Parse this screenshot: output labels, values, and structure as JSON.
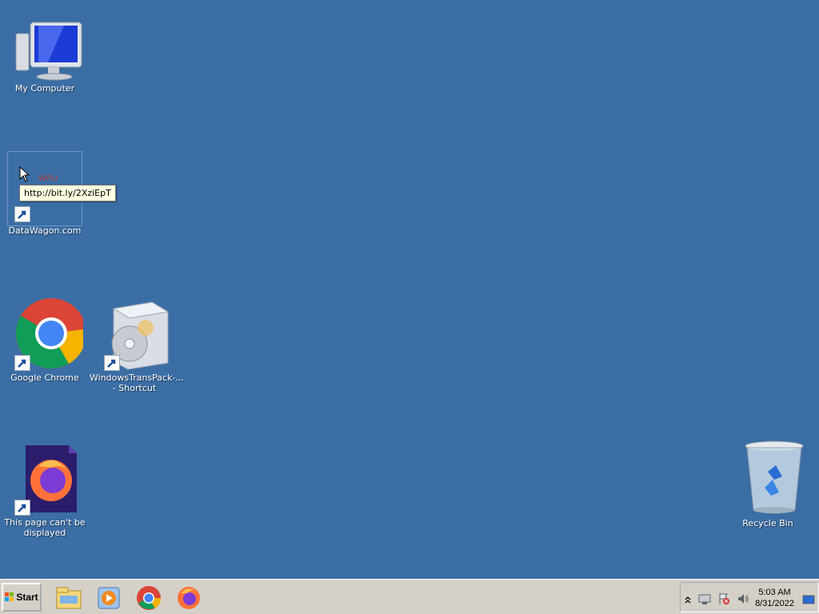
{
  "desktop": {
    "icons": [
      {
        "label": "My Computer"
      },
      {
        "label": "DataWagon.com"
      },
      {
        "label": "Google Chrome"
      },
      {
        "label": "WindowsTransPack-... - Shortcut"
      },
      {
        "label": "This page can't be displayed"
      },
      {
        "label": "Recycle Bin"
      }
    ],
    "tooltip": "http://bit.ly/2XziEpT"
  },
  "taskbar": {
    "start_label": "Start",
    "pinned": [
      {
        "icon": "file-explorer-icon"
      },
      {
        "icon": "media-player-icon"
      },
      {
        "icon": "chrome-icon"
      },
      {
        "icon": "firefox-icon"
      }
    ],
    "tray": {
      "time": "5:03 AM",
      "date": "8/31/2022"
    }
  },
  "colors": {
    "desktop_bg": "#3b6ea5",
    "taskbar_bg": "#d4d0c8",
    "tooltip_bg": "#ffffe1"
  }
}
